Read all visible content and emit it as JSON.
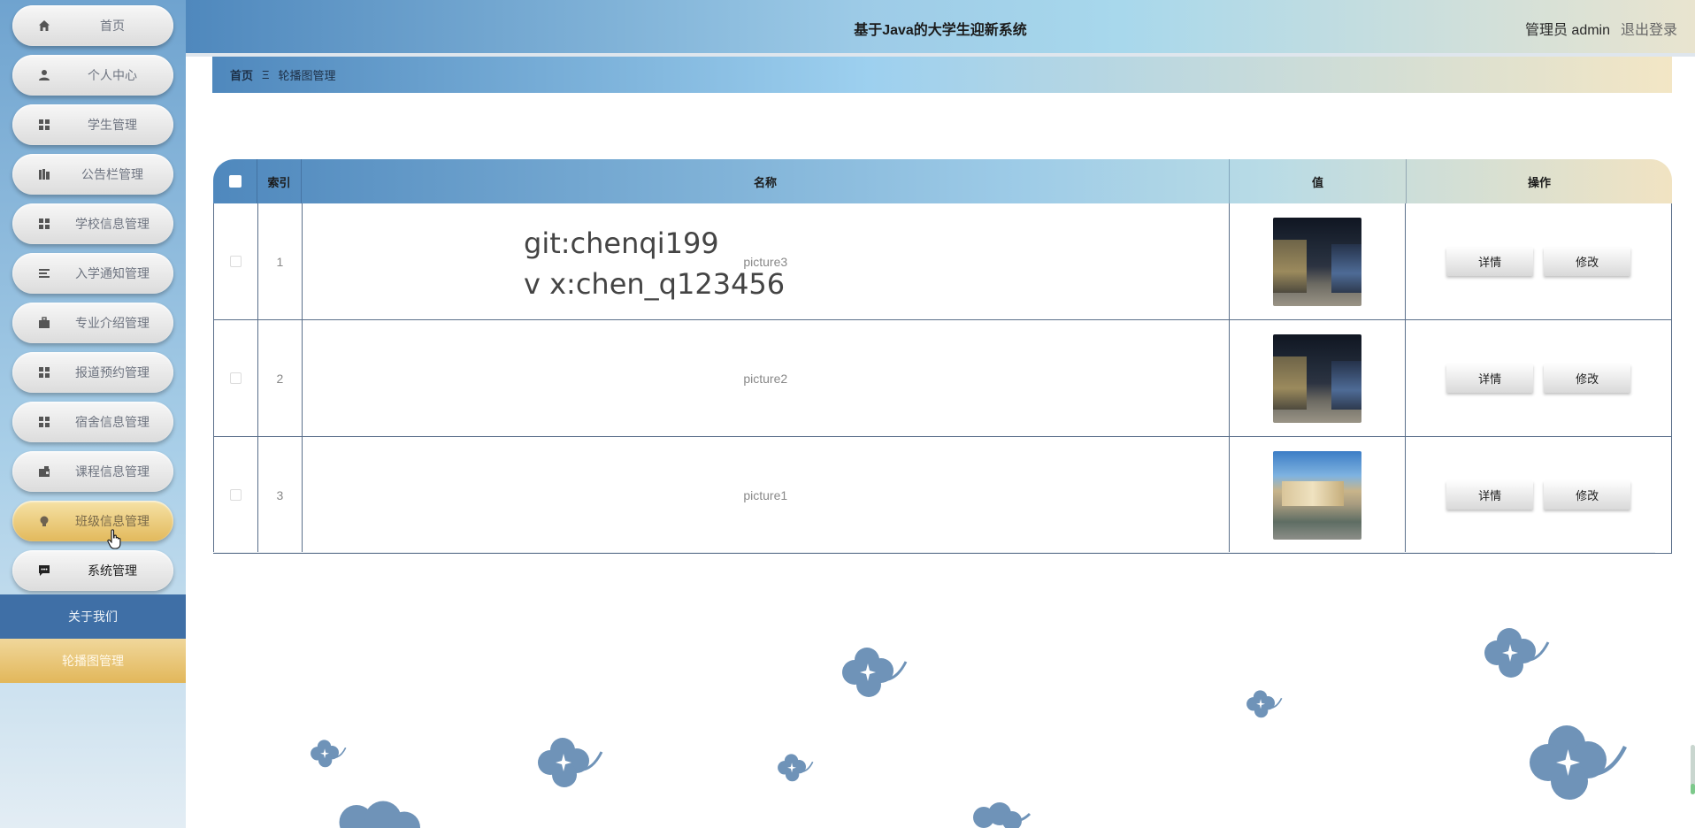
{
  "app": {
    "title": "基于Java的大学生迎新系统",
    "user_label": "管理员 admin",
    "logout_label": "退出登录"
  },
  "sidebar": {
    "items": [
      {
        "label": "首页",
        "icon": "home-icon"
      },
      {
        "label": "个人中心",
        "icon": "user-icon"
      },
      {
        "label": "学生管理",
        "icon": "grid-icon"
      },
      {
        "label": "公告栏管理",
        "icon": "bars-icon"
      },
      {
        "label": "学校信息管理",
        "icon": "grid-icon"
      },
      {
        "label": "入学通知管理",
        "icon": "list-icon"
      },
      {
        "label": "专业介绍管理",
        "icon": "briefcase-icon"
      },
      {
        "label": "报道预约管理",
        "icon": "grid-icon"
      },
      {
        "label": "宿舍信息管理",
        "icon": "grid-icon"
      },
      {
        "label": "课程信息管理",
        "icon": "wallet-icon"
      },
      {
        "label": "班级信息管理",
        "icon": "bulb-icon"
      },
      {
        "label": "系统管理",
        "icon": "chat-icon"
      }
    ],
    "submenu": {
      "about": "关于我们",
      "banner": "轮播图管理"
    }
  },
  "breadcrumb": {
    "home": "首页",
    "separator": "Ξ",
    "current": "轮播图管理"
  },
  "table": {
    "columns": [
      "索引",
      "名称",
      "值",
      "操作"
    ],
    "rows": [
      {
        "index": "1",
        "name": "picture3",
        "image": "night-campus",
        "detail": "详情",
        "edit": "修改"
      },
      {
        "index": "2",
        "name": "picture2",
        "image": "night-campus",
        "detail": "详情",
        "edit": "修改"
      },
      {
        "index": "3",
        "name": "picture1",
        "image": "day-building",
        "detail": "详情",
        "edit": "修改"
      }
    ]
  },
  "watermark": {
    "line1": "git:chenqi199",
    "line2": "v x:chen_q123456"
  },
  "colors": {
    "clover": "#6f93b8",
    "sidebar_active": "#e2b95c",
    "submenu_blue": "#3f6fa6"
  }
}
